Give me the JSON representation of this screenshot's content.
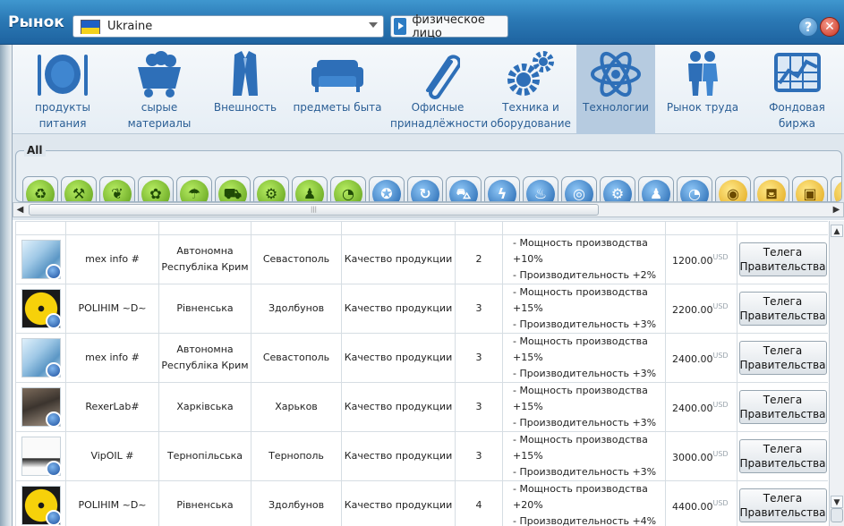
{
  "window": {
    "title": "Рынок",
    "country": "Ukraine",
    "person_type": "физическое лицо",
    "help": "?",
    "close": "✕"
  },
  "categories": [
    {
      "label": "продукты питания",
      "icon": "plate-cutlery-icon"
    },
    {
      "label": "сырые материалы",
      "icon": "mine-cart-icon"
    },
    {
      "label": "Внешность",
      "icon": "suit-icon"
    },
    {
      "label": "предметы быта",
      "icon": "sofa-icon"
    },
    {
      "label": "Офисные принадлёжности",
      "icon": "paperclip-icon"
    },
    {
      "label": "Техника и оборудование",
      "icon": "gears-icon"
    },
    {
      "label": "Технологии",
      "icon": "atom-icon"
    },
    {
      "label": "Рынок труда",
      "icon": "people-icon"
    },
    {
      "label": "Фондовая биржа",
      "icon": "stock-chart-icon"
    }
  ],
  "active_category": "Технологии",
  "tools": {
    "all_label": "All",
    "items": [
      "recycle-icon",
      "shovel-pick-icon",
      "vegetables-icon",
      "sprout-icon",
      "watering-can-icon",
      "harvester-icon",
      "gears-green-icon",
      "worker-icon",
      "gauge-icon",
      "medal-icon",
      "refresh-icon",
      "wheelbarrow-icon",
      "lightning-icon",
      "water-tap-icon",
      "gear-blue-icon",
      "gears-blue-icon",
      "worker-blue-icon",
      "speedometer-icon",
      "globe-coin-icon",
      "hand-truck-icon",
      "box-icon"
    ]
  },
  "table": {
    "rows": [
      {
        "company": "mex info #",
        "region": "Автономна Республіка Крим",
        "city": "Севастополь",
        "type": "Качество продукции",
        "level": "2",
        "effect1": "- Мощность производства +10%",
        "effect2": "- Производительность +2%",
        "price": "1200.00",
        "currency": "USD",
        "button": "Телега Правительства",
        "image": "steel"
      },
      {
        "company": "POLIHIM ~D~",
        "region": "Рівненська",
        "city": "Здолбунов",
        "type": "Качество продукции",
        "level": "3",
        "effect1": "- Мощность производства +15%",
        "effect2": "- Производительность +3%",
        "price": "2200.00",
        "currency": "USD",
        "button": "Телега Правительства",
        "image": "nuclear"
      },
      {
        "company": "mex info #",
        "region": "Автономна Республіка Крим",
        "city": "Севастополь",
        "type": "Качество продукции",
        "level": "3",
        "effect1": "- Мощность производства +15%",
        "effect2": "- Производительность +3%",
        "price": "2400.00",
        "currency": "USD",
        "button": "Телега Правительства",
        "image": "steel"
      },
      {
        "company": "RexerLab#",
        "region": "Харківська",
        "city": "Харьков",
        "type": "Качество продукции",
        "level": "3",
        "effect1": "- Мощность производства +15%",
        "effect2": "- Производительность +3%",
        "price": "2400.00",
        "currency": "USD",
        "button": "Телега Правительства",
        "image": "rexer"
      },
      {
        "company": "VipOIL #",
        "region": "Тернопільська",
        "city": "Тернополь",
        "type": "Качество продукции",
        "level": "3",
        "effect1": "- Мощность производства +15%",
        "effect2": "- Производительность +3%",
        "price": "3000.00",
        "currency": "USD",
        "button": "Телега Правительства",
        "image": "oil"
      },
      {
        "company": "POLIHIM ~D~",
        "region": "Рівненська",
        "city": "Здолбунов",
        "type": "Качество продукции",
        "level": "4",
        "effect1": "- Мощность производства +20%",
        "effect2": "- Производительность +4%",
        "price": "4400.00",
        "currency": "USD",
        "button": "Телега Правительства",
        "image": "nuclear"
      }
    ]
  },
  "scrollbar": {
    "grip": "|||",
    "left": "◀",
    "right": "▶",
    "up": "▲",
    "down": "▼"
  }
}
